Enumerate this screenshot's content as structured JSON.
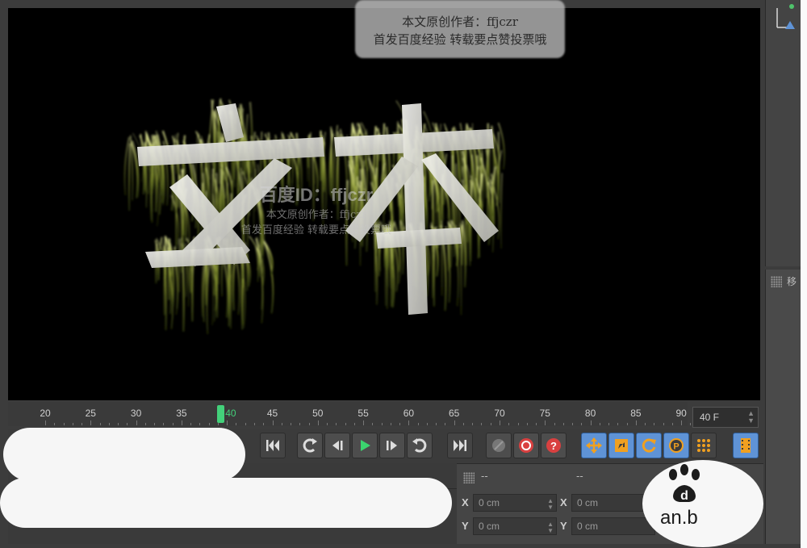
{
  "watermark": {
    "author_line": "本文原创作者：ffjczr",
    "notice_line": "首发百度经验 转载要点赞投票哦",
    "id_line": "百度ID：ffjczr",
    "mid_line1": "本文原创作者：ffjczr",
    "mid_line2": "首发百度经验 转载要点赞投票哦"
  },
  "viewport": {
    "text_object": "文本"
  },
  "timeline": {
    "ticks": [
      "20",
      "25",
      "30",
      "35",
      "40",
      "45",
      "50",
      "55",
      "60",
      "65",
      "70",
      "75",
      "80",
      "85",
      "90"
    ],
    "current_frame": "40",
    "frame_field": "40 F"
  },
  "right_panel": {
    "label": "移"
  },
  "coordinates": {
    "header_left": "--",
    "header_right": "--",
    "x_label": "X",
    "y_label": "Y",
    "x_position": "0 cm",
    "x_size": "0 cm",
    "y_position": "0 cm",
    "y_size": "0 cm"
  },
  "logo": {
    "text": "an.b"
  },
  "colors": {
    "background": "#3c3c3c",
    "viewport": "#000000",
    "playhead": "#43d17a",
    "active_tool": "#5f93d6",
    "record": "#d94040"
  }
}
